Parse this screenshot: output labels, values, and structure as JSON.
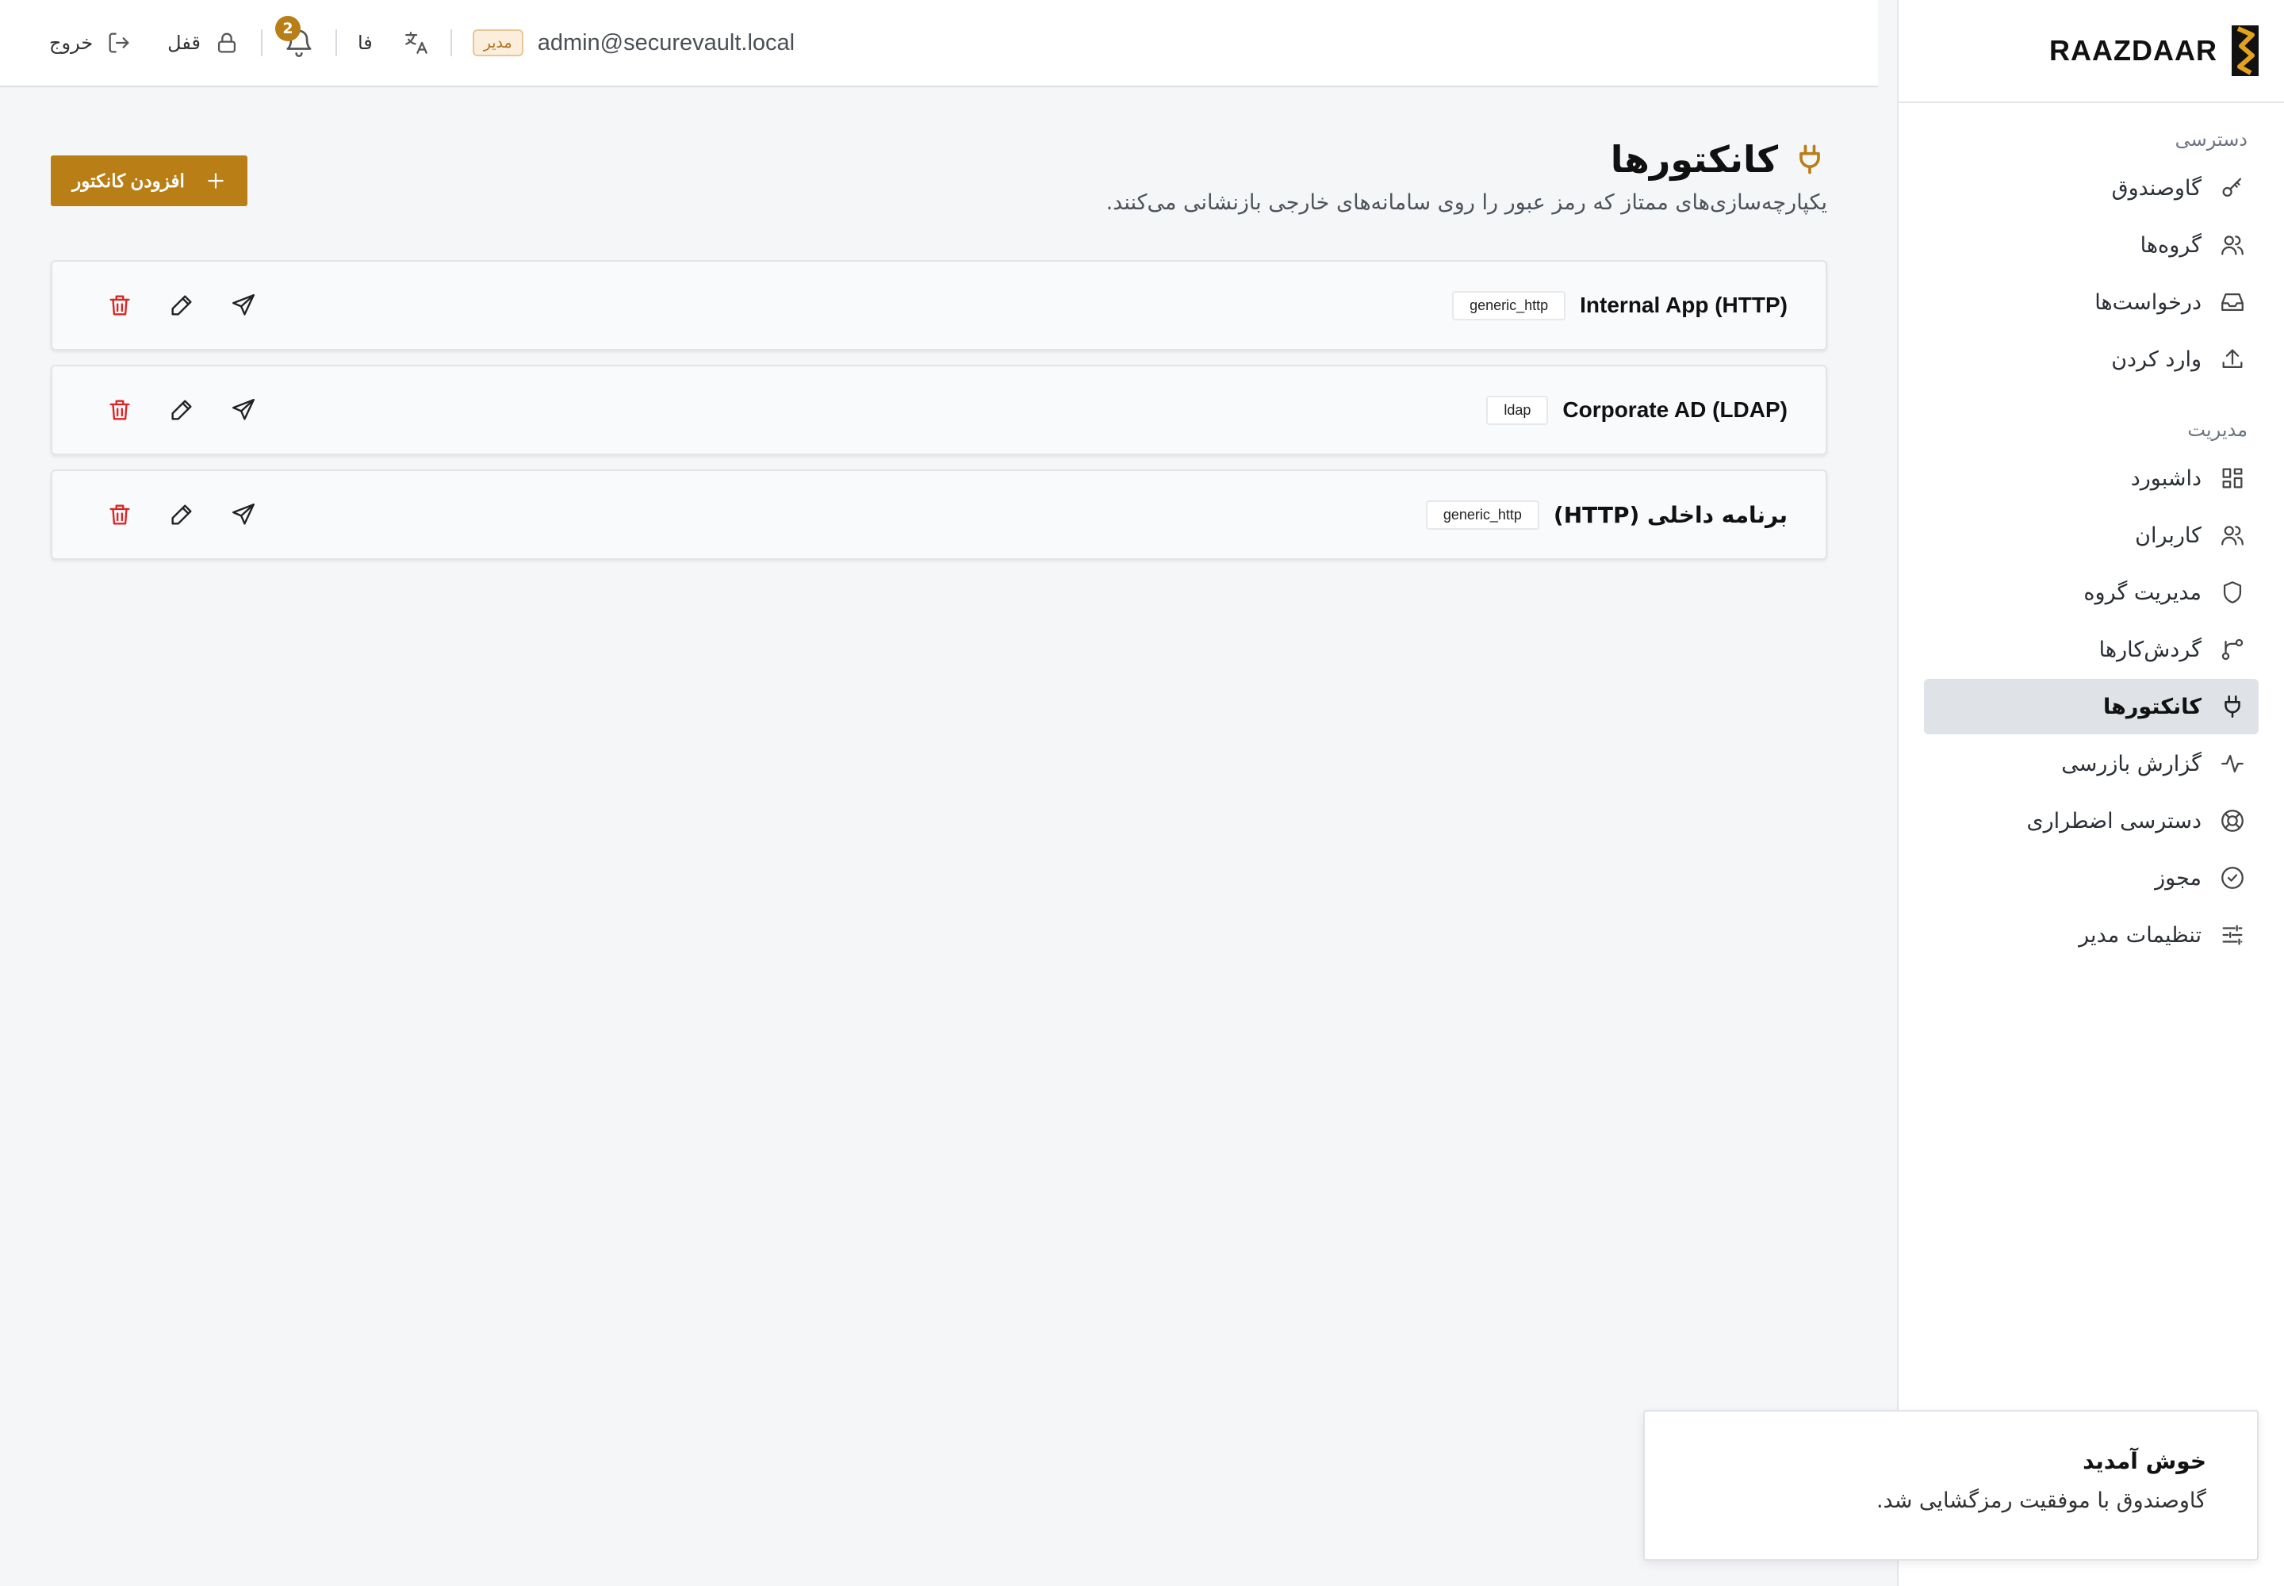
{
  "brand": {
    "name": "RAAZDAAR",
    "accent": "#b97e16"
  },
  "topbar": {
    "logout_label": "خروج",
    "lock_label": "قفل",
    "notification_count": "2",
    "language_label": "فا",
    "role_badge": "مدیر",
    "user_email": "admin@securevault.local"
  },
  "sidebar": {
    "sections": [
      {
        "title": "دسترسی",
        "items": [
          {
            "label": "گاوصندوق",
            "icon": "key-icon"
          },
          {
            "label": "گروه‌ها",
            "icon": "users-icon"
          },
          {
            "label": "درخواست‌ها",
            "icon": "inbox-icon"
          },
          {
            "label": "وارد کردن",
            "icon": "upload-icon"
          }
        ]
      },
      {
        "title": "مدیریت",
        "items": [
          {
            "label": "داشبورد",
            "icon": "dashboard-icon"
          },
          {
            "label": "کاربران",
            "icon": "users-icon"
          },
          {
            "label": "مدیریت گروه",
            "icon": "shield-icon"
          },
          {
            "label": "گردش‌کارها",
            "icon": "workflow-icon"
          },
          {
            "label": "کانکتورها",
            "icon": "plug-icon",
            "active": true
          },
          {
            "label": "گزارش بازرسی",
            "icon": "activity-icon"
          },
          {
            "label": "دسترسی اضطراری",
            "icon": "lifebuoy-icon"
          },
          {
            "label": "مجوز",
            "icon": "badge-check-icon"
          },
          {
            "label": "تنظیمات مدیر",
            "icon": "sliders-icon"
          }
        ]
      }
    ]
  },
  "page": {
    "title": "کانکتورها",
    "subtitle": "یکپارچه‌سازی‌های ممتاز که رمز عبور را روی سامانه‌های خارجی بازنشانی می‌کنند.",
    "add_button": "افزودن کانکتور"
  },
  "connectors": [
    {
      "name": "Internal App (HTTP)",
      "type": "generic_http"
    },
    {
      "name": "Corporate AD (LDAP)",
      "type": "ldap"
    },
    {
      "name": "برنامه داخلی (HTTP)",
      "type": "generic_http"
    }
  ],
  "toast": {
    "title": "خوش آمدید",
    "message": "گاوصندوق با موفقیت رمزگشایی شد."
  }
}
